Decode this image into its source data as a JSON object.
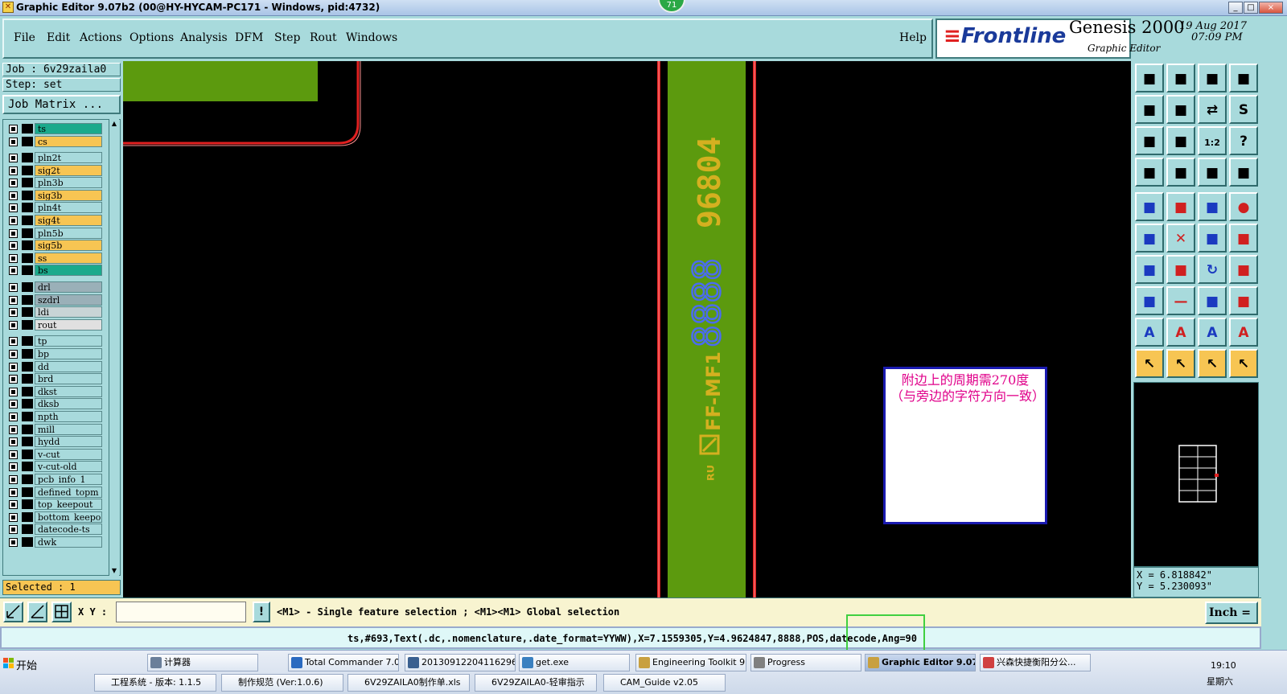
{
  "window": {
    "title": "Graphic Editor 9.07b2 (00@HY-HYCAM-PC171 - Windows, pid:4732)",
    "badge": "71",
    "min": "_",
    "max": "□",
    "close": "×"
  },
  "menu": [
    {
      "label": "File"
    },
    {
      "label": "Edit"
    },
    {
      "label": "Actions"
    },
    {
      "label": "Options"
    },
    {
      "label": "Analysis"
    },
    {
      "label": "DFM"
    },
    {
      "label": "Step"
    },
    {
      "label": "Rout"
    },
    {
      "label": "Windows"
    },
    {
      "label": "Help"
    }
  ],
  "brand": {
    "logo": "Frontline",
    "product": "Genesis 2000",
    "subtitle": "Graphic Editor",
    "date": "19 Aug 2017",
    "time": "07:09 PM"
  },
  "job": {
    "job_label": "Job : 6v29zaila0",
    "step_label": "Step: set",
    "matrix_button": "Job Matrix ...",
    "selected_label": "Selected : 1"
  },
  "layers": [
    {
      "name": "ts",
      "color": "#1aaa8c"
    },
    {
      "name": "cs",
      "color": "#f7c553"
    },
    {
      "name": "pln2t",
      "color": "#a8dadc"
    },
    {
      "name": "sig2t",
      "color": "#f7c553"
    },
    {
      "name": "pln3b",
      "color": "#a8dadc"
    },
    {
      "name": "sig3b",
      "color": "#f7c553"
    },
    {
      "name": "pln4t",
      "color": "#a8dadc"
    },
    {
      "name": "sig4t",
      "color": "#f7c553"
    },
    {
      "name": "pln5b",
      "color": "#a8dadc"
    },
    {
      "name": "sig5b",
      "color": "#f7c553"
    },
    {
      "name": "ss",
      "color": "#f7c553"
    },
    {
      "name": "bs",
      "color": "#1aaa8c"
    },
    {
      "name": "drl",
      "color": "#9ab0b8"
    },
    {
      "name": "szdrl",
      "color": "#9ab0b8"
    },
    {
      "name": "ldi",
      "color": "#c8d4d6"
    },
    {
      "name": "rout",
      "color": "#e0e0e0"
    },
    {
      "name": "tp",
      "color": "#a8dadc"
    },
    {
      "name": "bp",
      "color": "#a8dadc"
    },
    {
      "name": "dd",
      "color": "#a8dadc"
    },
    {
      "name": "brd",
      "color": "#a8dadc"
    },
    {
      "name": "dkst",
      "color": "#a8dadc"
    },
    {
      "name": "dksb",
      "color": "#a8dadc"
    },
    {
      "name": "npth",
      "color": "#a8dadc"
    },
    {
      "name": "mill",
      "color": "#a8dadc"
    },
    {
      "name": "hydd",
      "color": "#a8dadc"
    },
    {
      "name": "v-cut",
      "color": "#a8dadc"
    },
    {
      "name": "v-cut-old",
      "color": "#a8dadc"
    },
    {
      "name": "pcb_info_1",
      "color": "#a8dadc"
    },
    {
      "name": "defined_topm",
      "color": "#a8dadc"
    },
    {
      "name": "top_keepout",
      "color": "#a8dadc"
    },
    {
      "name": "bottom_keepo",
      "color": "#a8dadc"
    },
    {
      "name": "datecode-ts",
      "color": "#a8dadc"
    },
    {
      "name": "dwk",
      "color": "#a8dadc"
    }
  ],
  "canvas": {
    "text_yellow": "96804",
    "text_blue": "8888",
    "text_mark": "FF-MF1",
    "note": "附边上的周期需270度（与旁边的字符方向一致）",
    "colors": {
      "green": "#5c9a0e",
      "red": "#e02020",
      "yellow": "#d4b020",
      "blue": "#4a6cf0",
      "note_text": "#e0008a"
    }
  },
  "coords": {
    "x": "X = 6.818842\"",
    "y": "Y = 5.230093\""
  },
  "bottom": {
    "xy_label": "X Y :",
    "xy_value": "",
    "msg_icon": "!",
    "message": "<M1> - Single feature selection ; <M1><M1> Global selection",
    "unit": "Inch ="
  },
  "status": "ts,#693,Text(.dc,.nomenclature,.date_format=YYWW),X=7.1559305,Y=4.9624847,8888,POS,datecode,Ang=90",
  "taskbar": {
    "start": "开始",
    "tasks": [
      "计算器",
      "Total Commander 7.0...",
      "20130912204116296...",
      "get.exe",
      "Engineering Toolkit 9....",
      "Progress",
      "Graphic Editor 9.07...",
      "兴森快捷衡阳分公..."
    ],
    "tasks2": [
      "工程系统 - 版本: 1.1.5",
      "制作规范 (Ver:1.0.6)",
      "6V29ZAILA0制作单.xls",
      "6V29ZAILA0-轻审指示",
      "CAM_Guide v2.05"
    ],
    "clock": "19:10",
    "weekday": "星期六"
  }
}
